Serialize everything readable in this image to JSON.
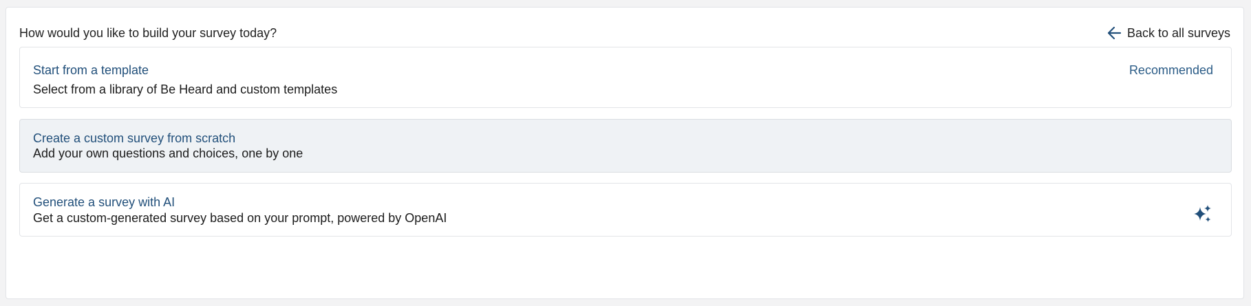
{
  "header": {
    "question": "How would you like to build your survey today?",
    "back_label": "Back to all surveys"
  },
  "options": [
    {
      "title": "Start from a template",
      "description": "Select from a library of Be Heard and custom templates",
      "badge": "Recommended"
    },
    {
      "title": "Create a custom survey from scratch",
      "description": "Add your own questions and choices, one by one"
    },
    {
      "title": "Generate a survey with AI",
      "description": "Get a custom-generated survey based on your prompt, powered by OpenAI",
      "icon": "sparkles-icon"
    }
  ],
  "colors": {
    "accent": "#214f7a",
    "highlight_bg": "#eff2f5",
    "border": "#e2e4e7"
  }
}
